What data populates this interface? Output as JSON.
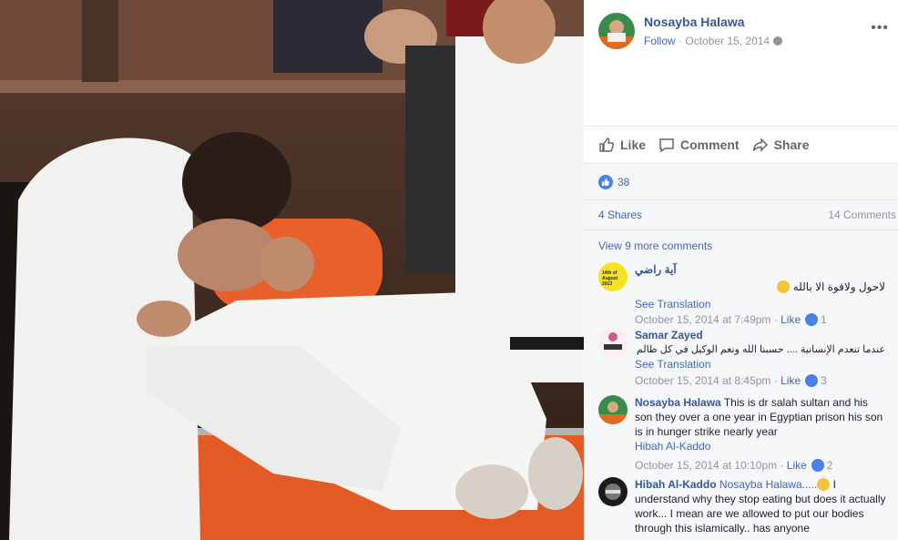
{
  "post": {
    "author": "Nosayba Halawa",
    "follow": "Follow",
    "separator": " · ",
    "date": "October 15, 2014",
    "more": "•••"
  },
  "actions": {
    "like": "Like",
    "comment": "Comment",
    "share": "Share"
  },
  "stats": {
    "reactions": "38",
    "shares": "4 Shares",
    "comments": "14 Comments"
  },
  "view_more": "View 9 more comments",
  "comments": [
    {
      "name": "آية راضي",
      "avatar_text": "14th of August 2013",
      "text": "لاحول ولاقوة الا بالله",
      "see_translation": "See Translation",
      "date": "October 15, 2014 at 7:49pm",
      "sep": " · ",
      "like": "Like",
      "likes": "1"
    },
    {
      "name": "Samar Zayed",
      "text": "عندما تنعدم الإنسانية .... حسبنا الله ونعم الوكيل في كل ظالم",
      "see_translation": "See Translation",
      "date": "October 15, 2014 at 8:45pm",
      "sep": " · ",
      "like": "Like",
      "likes": "3"
    },
    {
      "name": "Nosayba Halawa",
      "text": "This is dr salah sultan and his son they over a one year in Egyptian prison his son is in hunger strike nearly year",
      "mention": "Hibah Al-Kaddo",
      "date": "October 15, 2014 at 10:10pm",
      "sep": " · ",
      "like": "Like",
      "likes": "2"
    },
    {
      "name": "Hibah Al-Kaddo",
      "mention": "Nosayba Halawa.....",
      "text": "I understand why they stop eating but does it actually work... I mean are we allowed to put our bodies through this islamically.. has anyone"
    }
  ],
  "colors": {
    "link": "#365899",
    "accent": "#4267b2",
    "muted": "#90949c",
    "like_blue": "#4a80e8"
  },
  "icons": [
    "globe-icon",
    "more-icon",
    "like-icon",
    "comment-icon",
    "share-icon",
    "like-reaction-icon",
    "crying-emoji-icon"
  ]
}
